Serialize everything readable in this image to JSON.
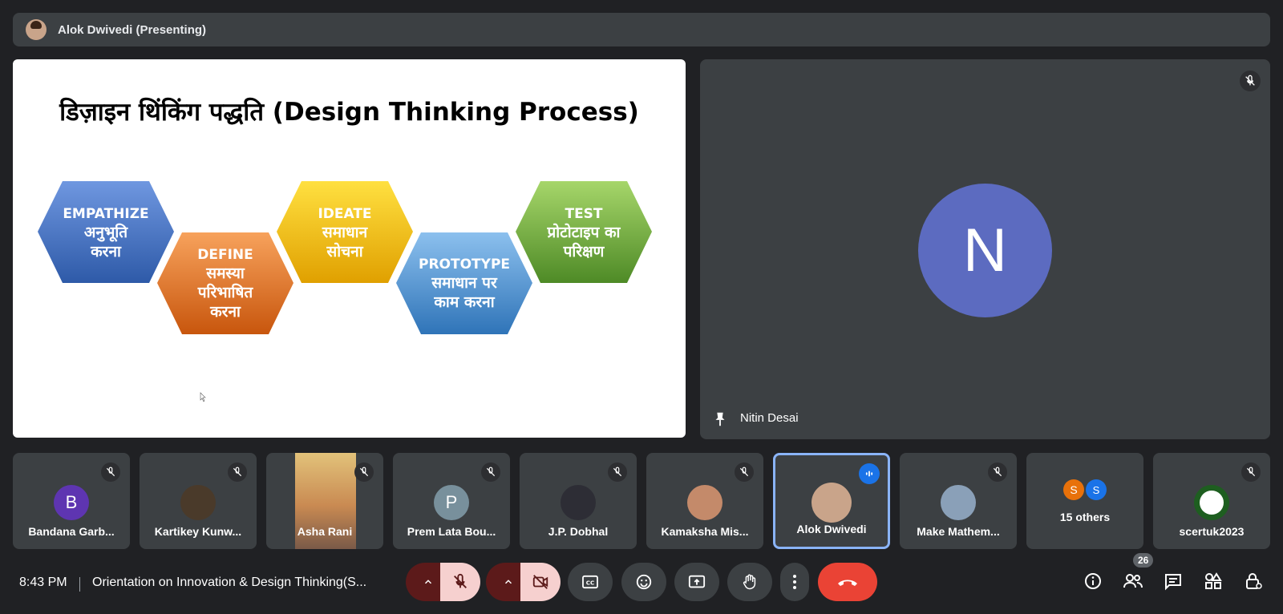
{
  "presenter_bar": {
    "label": "Alok Dwivedi (Presenting)"
  },
  "slide": {
    "title": "डिज़ाइन  थिंकिंग पद्धति  (Design Thinking Process)",
    "steps": [
      {
        "en": "EMPATHIZE",
        "hi1": "अनुभूति",
        "hi2": "करना",
        "color": "#4a78c8"
      },
      {
        "en": "DEFINE",
        "hi1": "समस्या",
        "hi2": "परिभाषित",
        "hi3": "करना",
        "color": "#e6741f"
      },
      {
        "en": "IDEATE",
        "hi1": "समाधान",
        "hi2": "सोचना",
        "color": "#f3b800"
      },
      {
        "en": "PROTOTYPE",
        "hi1": "समाधान पर",
        "hi2": "काम करना",
        "color": "#4a90d0"
      },
      {
        "en": "TEST",
        "hi1": "प्रोटोटाइप का",
        "hi2": "परिक्षण",
        "color": "#6aa83a"
      }
    ]
  },
  "speaker": {
    "name": "Nitin Desai",
    "initial": "N",
    "avatar_color": "#5c6bc0"
  },
  "participants": [
    {
      "name": "Bandana Garb...",
      "initial": "B",
      "color": "#5e35b1"
    },
    {
      "name": "Kartikey Kunw...",
      "initial": "",
      "color": "#4a3a2a"
    },
    {
      "name": "Asha Rani",
      "initial": "",
      "color": "#d8b070"
    },
    {
      "name": "Prem Lata Bou...",
      "initial": "P",
      "color": "#78909c"
    },
    {
      "name": "J.P. Dobhal",
      "initial": "",
      "color": "#2d2d35"
    },
    {
      "name": "Kamaksha Mis...",
      "initial": "",
      "color": "#c48a6a"
    },
    {
      "name": "Alok Dwivedi",
      "initial": "",
      "color": "#c9a48a"
    },
    {
      "name": "Make Mathem...",
      "initial": "",
      "color": "#8aa0b8"
    },
    {
      "name": "15 others",
      "initial1": "S",
      "initial2": "S",
      "color1": "#e8710a",
      "color2": "#1a73e8"
    },
    {
      "name": "scertuk2023",
      "initial": "",
      "color": "#1e5e20"
    }
  ],
  "bottom_bar": {
    "time": "8:43 PM",
    "meeting_title": "Orientation on Innovation & Design Thinking(S...",
    "participants_count": "26"
  },
  "icons": [
    "mic-off-icon",
    "camera-off-icon",
    "captions-icon",
    "emoji-icon",
    "present-icon",
    "raise-hand-icon",
    "more-icon",
    "end-call-icon",
    "info-icon",
    "people-icon",
    "chat-icon",
    "activities-icon",
    "host-controls-icon",
    "pin-icon"
  ]
}
